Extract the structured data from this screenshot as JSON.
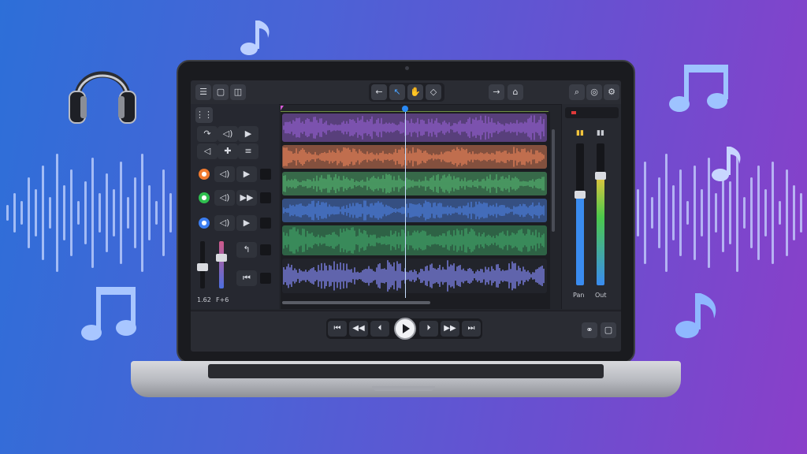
{
  "colors": {
    "track_purple": "#8a5bc4",
    "track_orange": "#d97a55",
    "track_green": "#4ea86a",
    "track_blue": "#4a79d0",
    "track_green2": "#3e9a63",
    "track_blend": "#4c6dc4",
    "meter_green": "#4bc94b",
    "playhead": "#2a8af5"
  },
  "toolbar_left": [
    "menu-icon",
    "square-icon",
    "split-icon"
  ],
  "toolbar_center": [
    "undo-icon",
    "cursor-icon",
    "hand-icon",
    "shape-icon"
  ],
  "toolbar_mid": [
    "redo-icon",
    "home-icon"
  ],
  "toolbar_right": [
    "search-icon",
    "globe-icon",
    "settings-icon"
  ],
  "tracks": [
    {
      "name": "track-1",
      "color": "#8a5bc4"
    },
    {
      "name": "track-2",
      "color": "#d97a55"
    },
    {
      "name": "track-3",
      "color": "#4ea86a"
    },
    {
      "name": "track-4",
      "color": "#4a79d0"
    },
    {
      "name": "track-5",
      "color": "#3e9a63"
    },
    {
      "name": "track-6",
      "color": "#5a5fc8"
    }
  ],
  "mixer": {
    "left_label": "Pan",
    "right_label": "Out",
    "left_level": 0.64,
    "right_level": 0.58
  },
  "channel_labels": {
    "a": "1.62",
    "b": "F+6"
  }
}
